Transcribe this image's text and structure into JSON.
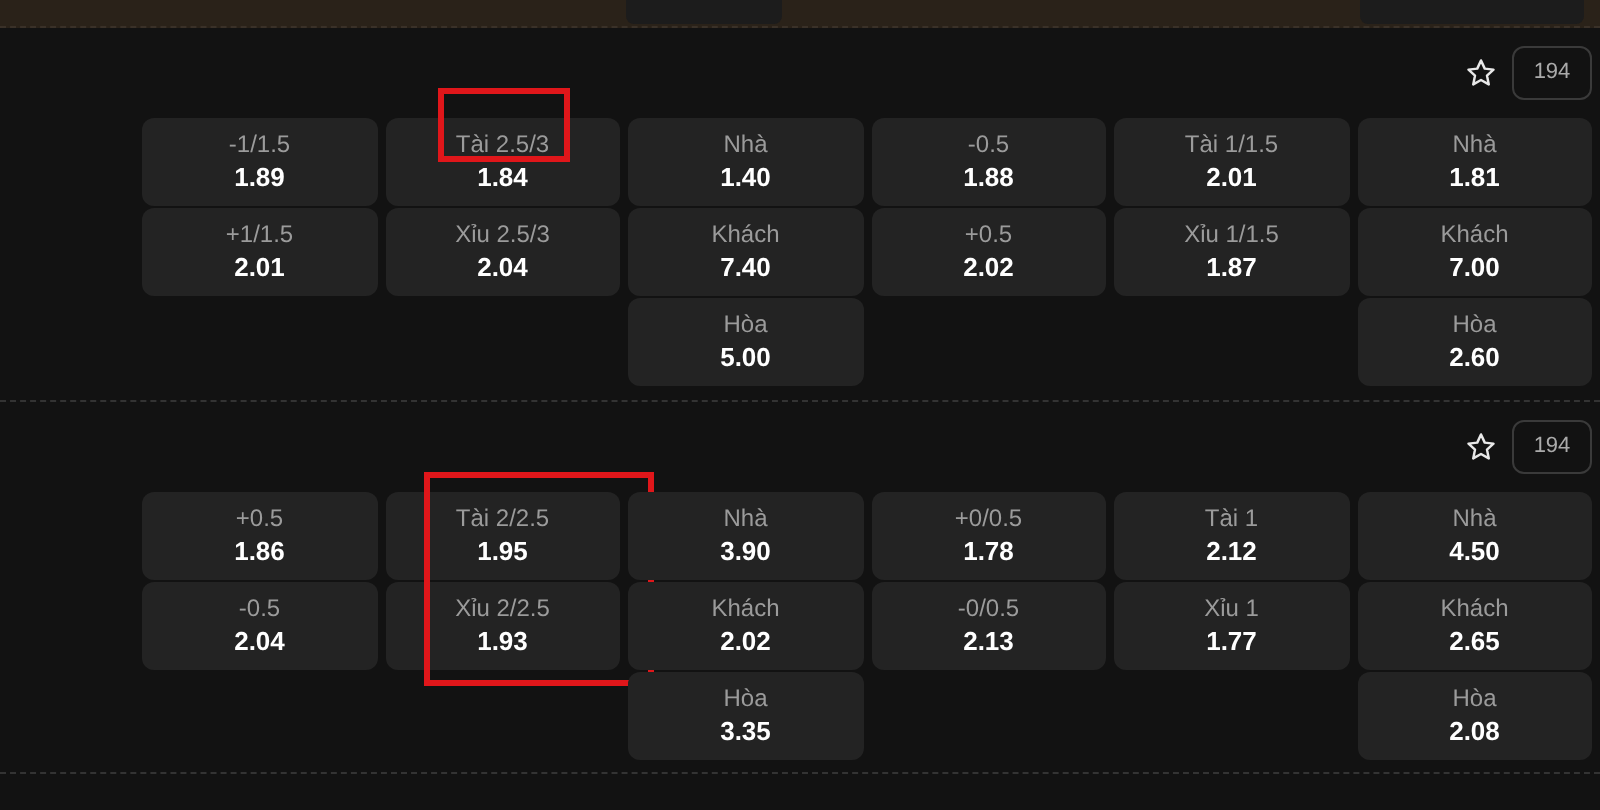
{
  "matches": [
    {
      "favorite": false,
      "count": "194",
      "columns": [
        {
          "cells": [
            {
              "label": "-1/1.5",
              "odds": "1.89",
              "highlighted": false
            },
            {
              "label": "+1/1.5",
              "odds": "2.01",
              "highlighted": false
            }
          ]
        },
        {
          "cells": [
            {
              "label": "Tài 2.5/3",
              "odds": "1.84",
              "highlighted": true
            },
            {
              "label": "Xỉu 2.5/3",
              "odds": "2.04",
              "highlighted": false
            }
          ]
        },
        {
          "cells": [
            {
              "label": "Nhà",
              "odds": "1.40",
              "highlighted": false
            },
            {
              "label": "Khách",
              "odds": "7.40",
              "highlighted": false
            },
            {
              "label": "Hòa",
              "odds": "5.00",
              "highlighted": false
            }
          ]
        },
        {
          "cells": [
            {
              "label": "-0.5",
              "odds": "1.88",
              "highlighted": false
            },
            {
              "label": "+0.5",
              "odds": "2.02",
              "highlighted": false
            }
          ]
        },
        {
          "cells": [
            {
              "label": "Tài 1/1.5",
              "odds": "2.01",
              "highlighted": false
            },
            {
              "label": "Xỉu 1/1.5",
              "odds": "1.87",
              "highlighted": false
            }
          ]
        },
        {
          "cells": [
            {
              "label": "Nhà",
              "odds": "1.81",
              "highlighted": false
            },
            {
              "label": "Khách",
              "odds": "7.00",
              "highlighted": false
            },
            {
              "label": "Hòa",
              "odds": "2.60",
              "highlighted": false
            }
          ]
        }
      ]
    },
    {
      "favorite": false,
      "count": "194",
      "columns": [
        {
          "cells": [
            {
              "label": "+0.5",
              "odds": "1.86",
              "highlighted": false
            },
            {
              "label": "-0.5",
              "odds": "2.04",
              "highlighted": false
            }
          ]
        },
        {
          "cells": [
            {
              "label": "Tài 2/2.5",
              "odds": "1.95",
              "highlighted": true
            },
            {
              "label": "Xỉu 2/2.5",
              "odds": "1.93",
              "highlighted": true
            }
          ]
        },
        {
          "cells": [
            {
              "label": "Nhà",
              "odds": "3.90",
              "highlighted": false
            },
            {
              "label": "Khách",
              "odds": "2.02",
              "highlighted": false
            },
            {
              "label": "Hòa",
              "odds": "3.35",
              "highlighted": false
            }
          ]
        },
        {
          "cells": [
            {
              "label": "+0/0.5",
              "odds": "1.78",
              "highlighted": false
            },
            {
              "label": "-0/0.5",
              "odds": "2.13",
              "highlighted": false
            }
          ]
        },
        {
          "cells": [
            {
              "label": "Tài 1",
              "odds": "2.12",
              "highlighted": false
            },
            {
              "label": "Xỉu 1",
              "odds": "1.77",
              "highlighted": false
            }
          ]
        },
        {
          "cells": [
            {
              "label": "Nhà",
              "odds": "4.50",
              "highlighted": false
            },
            {
              "label": "Khách",
              "odds": "2.65",
              "highlighted": false
            },
            {
              "label": "Hòa",
              "odds": "2.08",
              "highlighted": false
            }
          ]
        }
      ]
    }
  ]
}
